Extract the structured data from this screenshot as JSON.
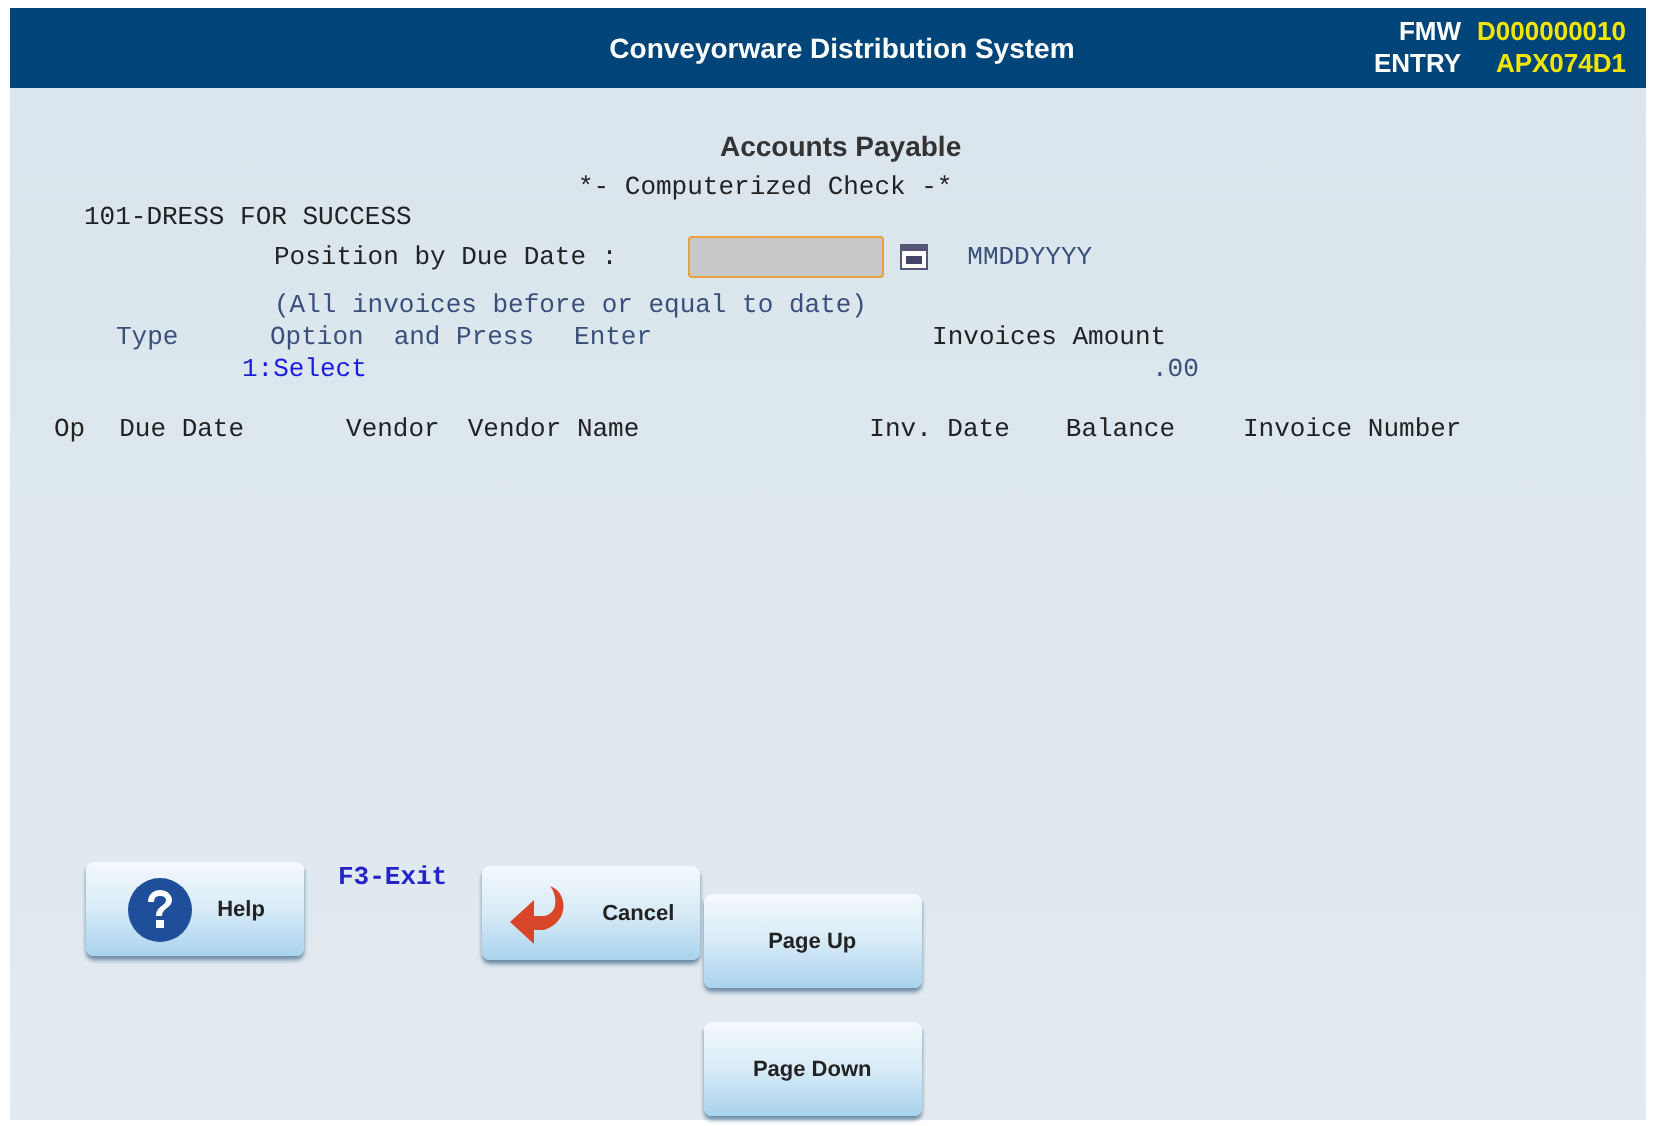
{
  "header": {
    "title": "Conveyorware Distribution System",
    "info": [
      {
        "label": "FMW",
        "value": "D000000010"
      },
      {
        "label": "ENTRY",
        "value": "APX074D1"
      }
    ]
  },
  "screen_title": "Accounts Payable",
  "subtitle": "*- Computerized Check -*",
  "company": "101-DRESS FOR SUCCESS",
  "position_prompt": "Position by Due Date :",
  "date_format": "MMDDYYYY",
  "note": "(All invoices before or equal to date)",
  "instructions": [
    "Type",
    "Option",
    "and Press",
    "Enter"
  ],
  "option": "1:Select",
  "invoices_amount_label": "Invoices Amount",
  "invoices_amount": ".00",
  "table": {
    "columns": [
      "Op",
      "Due Date",
      "Vendor",
      "Vendor Name",
      "Inv. Date",
      "Balance",
      "Invoice Number"
    ]
  },
  "f3_label": "F3-Exit",
  "buttons": [
    {
      "label": "Help",
      "kind": "help"
    },
    {
      "label": "Cancel",
      "kind": "cancel"
    },
    {
      "label": "Page Up",
      "kind": "plain"
    },
    {
      "label": "Page Down",
      "kind": "plain"
    }
  ]
}
